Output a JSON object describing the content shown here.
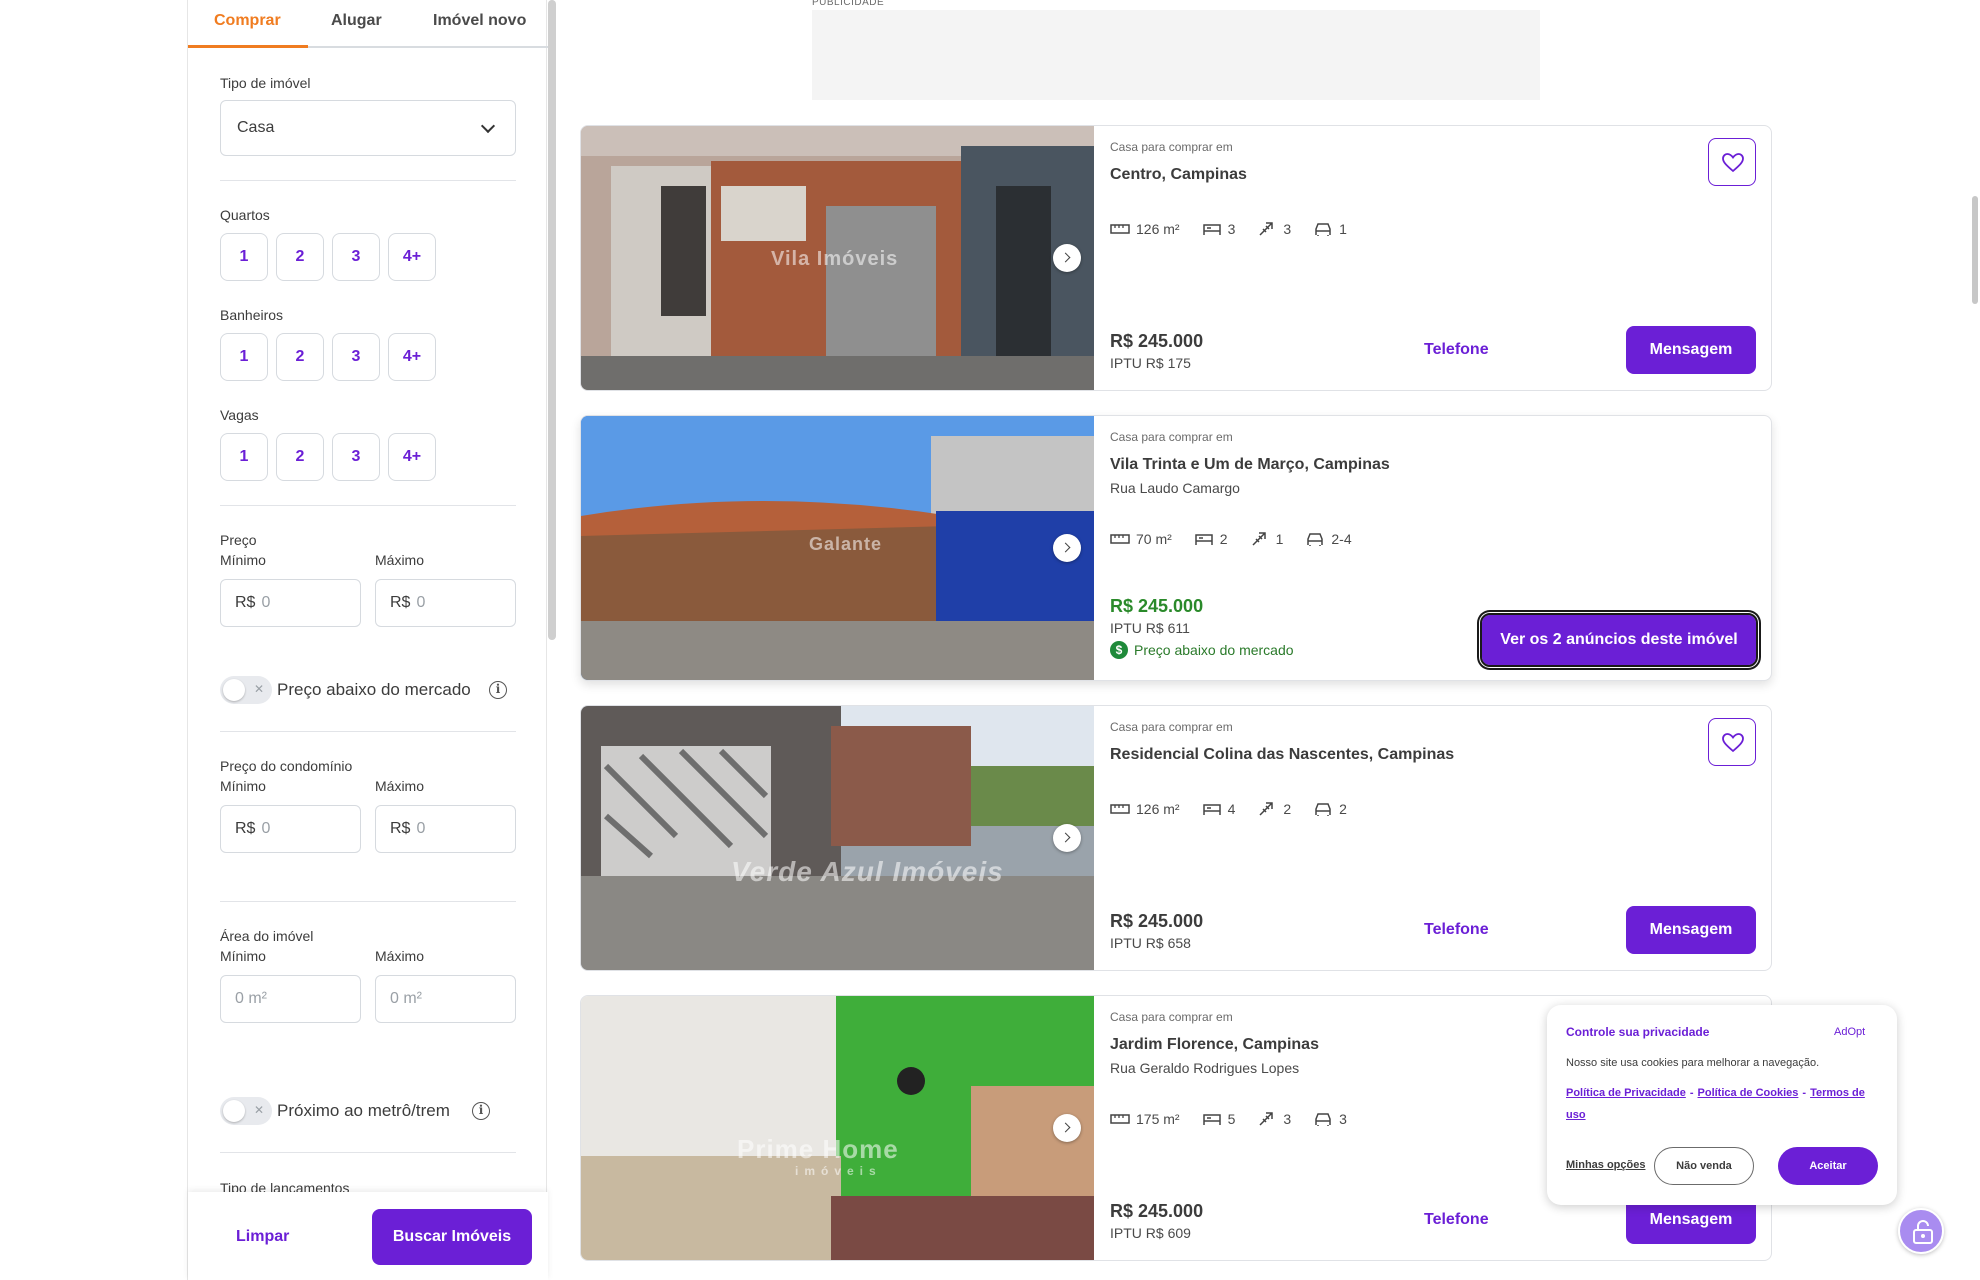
{
  "colors": {
    "accent": "#6b1fd6",
    "tab_active": "#f07c20",
    "price_good": "#2a8a2a"
  },
  "sidebar": {
    "tabs": [
      "Comprar",
      "Alugar",
      "Imóvel novo"
    ],
    "tipo_label": "Tipo de imóvel",
    "tipo_value": "Casa",
    "quartos_label": "Quartos",
    "banheiros_label": "Banheiros",
    "vagas_label": "Vagas",
    "chips": [
      "1",
      "2",
      "3",
      "4+"
    ],
    "preco_label": "Preço",
    "min_label": "Mínimo",
    "max_label": "Máximo",
    "currency": "R$",
    "zero": "0",
    "toggle_preco": "Preço abaixo do mercado",
    "condominio_label": "Preço do condomínio",
    "area_label": "Área do imóvel",
    "area_placeholder": "0 m²",
    "toggle_metro": "Próximo ao metrô/trem",
    "lancamentos_label": "Tipo de lançamentos",
    "limpar": "Limpar",
    "buscar": "Buscar Imóveis"
  },
  "ad": {
    "label": "PUBLICIDADE"
  },
  "listings": [
    {
      "subtitle": "Casa para comprar em",
      "title": "Centro, Campinas",
      "street": "",
      "area": "126 m²",
      "quartos": "3",
      "banheiros": "3",
      "vagas": "1",
      "price": "R$ 245.000",
      "iptu": "IPTU R$ 175",
      "watermark": "Vila Imóveis",
      "telefone": "Telefone",
      "mensagem": "Mensagem"
    },
    {
      "subtitle": "Casa para comprar em",
      "title": "Vila Trinta e Um de Março, Campinas",
      "street": "Rua Laudo Camargo",
      "area": "70 m²",
      "quartos": "2",
      "banheiros": "1",
      "vagas": "2-4",
      "price": "R$ 245.000",
      "iptu": "IPTU R$ 611",
      "below_market": "Preço abaixo do mercado",
      "watermark": "Galante",
      "ver_anuncios": "Ver os 2 anúncios deste imóvel"
    },
    {
      "subtitle": "Casa para comprar em",
      "title": "Residencial Colina das Nascentes, Campinas",
      "street": "",
      "area": "126 m²",
      "quartos": "4",
      "banheiros": "2",
      "vagas": "2",
      "price": "R$ 245.000",
      "iptu": "IPTU R$ 658",
      "watermark": "Verde Azul Imóveis",
      "telefone": "Telefone",
      "mensagem": "Mensagem"
    },
    {
      "subtitle": "Casa para comprar em",
      "title": "Jardim Florence, Campinas",
      "street": "Rua Geraldo Rodrigues Lopes",
      "area": "175 m²",
      "quartos": "5",
      "banheiros": "3",
      "vagas": "3",
      "price": "R$ 245.000",
      "iptu": "IPTU R$ 609",
      "watermark": "Prime Home",
      "watermark_sub": "imóveis",
      "telefone": "Telefone",
      "mensagem": "Mensagem"
    }
  ],
  "cookie": {
    "title": "Controle sua privacidade",
    "brand": "AdOpt",
    "text": "Nosso site usa cookies para melhorar a navegação.",
    "privacy": "Política de Privacidade",
    "cookies": "Política de Cookies",
    "terms": "Termos de uso",
    "sep": "-",
    "options": "Minhas opções",
    "decline": "Não venda",
    "accept": "Aceitar"
  }
}
